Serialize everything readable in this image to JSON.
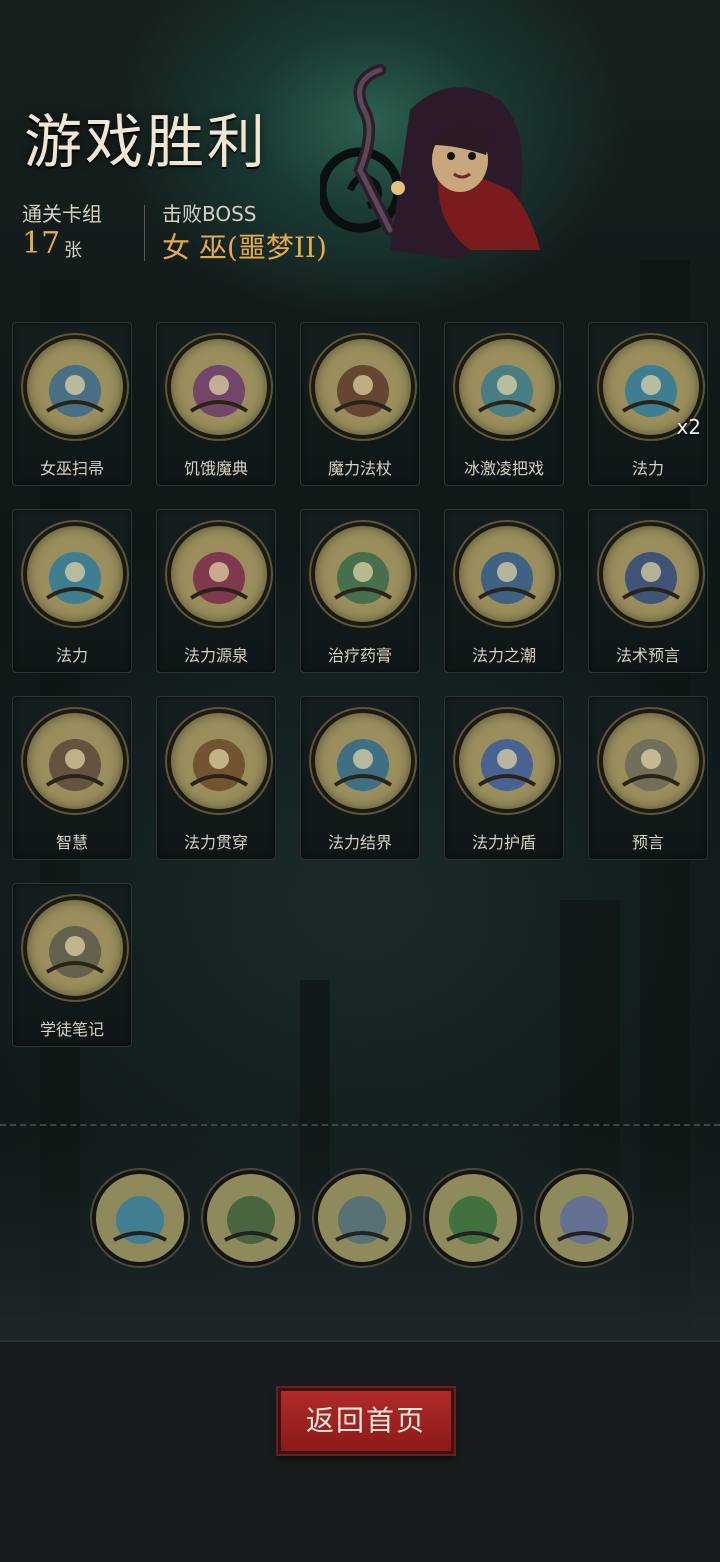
{
  "header": {
    "title": "游戏胜利",
    "deck_label": "通关卡组",
    "deck_count": "17",
    "deck_unit": "张",
    "boss_label": "击败BOSS",
    "boss_name": "女 巫(噩梦II)"
  },
  "cards": [
    {
      "name": "女巫扫帚",
      "icon": "broom-icon"
    },
    {
      "name": "饥饿魔典",
      "icon": "hungry-grimoire-icon"
    },
    {
      "name": "魔力法杖",
      "icon": "magic-staff-icon"
    },
    {
      "name": "冰激凌把戏",
      "icon": "ice-cream-icon"
    },
    {
      "name": "法力",
      "icon": "mana-orb-icon",
      "count": "x2"
    },
    {
      "name": "法力",
      "icon": "mana-orb-icon"
    },
    {
      "name": "法力源泉",
      "icon": "mana-fountain-icon"
    },
    {
      "name": "治疗药膏",
      "icon": "healing-ointment-icon"
    },
    {
      "name": "法力之潮",
      "icon": "mana-tide-icon"
    },
    {
      "name": "法术预言",
      "icon": "spell-prophecy-icon"
    },
    {
      "name": "智慧",
      "icon": "wisdom-icon"
    },
    {
      "name": "法力贯穿",
      "icon": "mana-pierce-icon"
    },
    {
      "name": "法力结界",
      "icon": "mana-barrier-icon"
    },
    {
      "name": "法力护盾",
      "icon": "mana-shield-icon"
    },
    {
      "name": "预言",
      "icon": "prophecy-icon"
    },
    {
      "name": "学徒笔记",
      "icon": "apprentice-notes-icon"
    }
  ],
  "relics": [
    {
      "icon": "water-magic-relic-icon"
    },
    {
      "icon": "banner-relic-icon"
    },
    {
      "icon": "stone-pillar-relic-icon"
    },
    {
      "icon": "green-spirit-relic-icon"
    },
    {
      "icon": "glowing-book-relic-icon"
    }
  ],
  "actions": {
    "home_label": "返回首页"
  }
}
